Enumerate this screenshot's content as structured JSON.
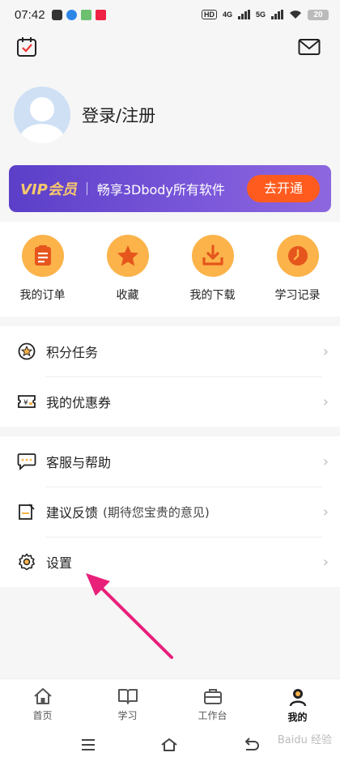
{
  "status_bar": {
    "time": "07:42",
    "hd": "HD",
    "net1": "4G",
    "net2": "5G",
    "battery": "20"
  },
  "profile": {
    "login_text": "登录/注册"
  },
  "vip": {
    "title": "VIP会员",
    "description": "畅享3Dbody所有软件",
    "button": "去开通"
  },
  "shortcuts": [
    {
      "label": "我的订单",
      "icon": "order-icon"
    },
    {
      "label": "收藏",
      "icon": "star-icon"
    },
    {
      "label": "我的下载",
      "icon": "download-icon"
    },
    {
      "label": "学习记录",
      "icon": "clock-icon"
    }
  ],
  "menu_group_1": [
    {
      "label": "积分任务",
      "icon": "points-icon"
    },
    {
      "label": "我的优惠券",
      "icon": "coupon-icon"
    }
  ],
  "menu_group_2": [
    {
      "label": "客服与帮助",
      "icon": "chat-icon"
    },
    {
      "label": "建议反馈",
      "hint": "(期待您宝贵的意见)",
      "icon": "feedback-icon"
    },
    {
      "label": "设置",
      "icon": "gear-icon"
    }
  ],
  "tabbar": [
    {
      "label": "首页",
      "icon": "home-icon"
    },
    {
      "label": "学习",
      "icon": "book-icon"
    },
    {
      "label": "工作台",
      "icon": "briefcase-icon"
    },
    {
      "label": "我的",
      "icon": "person-icon",
      "active": true
    }
  ],
  "watermark": "Baidu 经验",
  "colors": {
    "accent_orange": "#fbb34a",
    "vip_purple": "#6a4bd0",
    "vip_button": "#ff5b1f",
    "arrow": "#e8207a"
  }
}
